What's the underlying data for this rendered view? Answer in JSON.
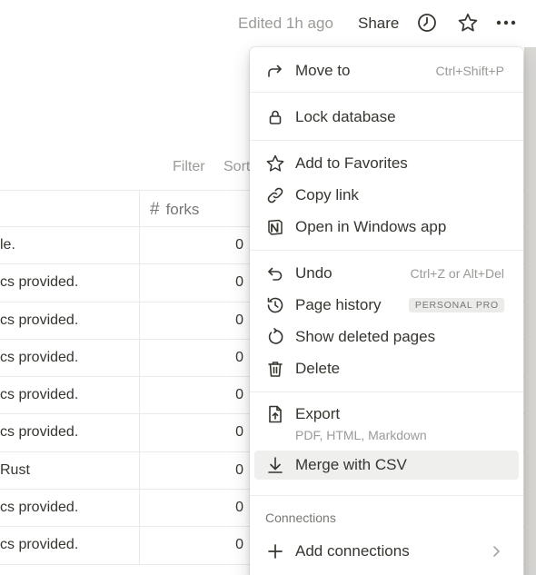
{
  "topbar": {
    "edited": "Edited 1h ago",
    "share": "Share",
    "icons": [
      "clock-icon",
      "star-icon",
      "more-icon"
    ]
  },
  "view": {
    "filter": "Filter",
    "sort": "Sort"
  },
  "table": {
    "forks_header": "forks",
    "rows": [
      {
        "desc": "le.",
        "forks": "0"
      },
      {
        "desc": "cs provided.",
        "forks": "0"
      },
      {
        "desc": "cs provided.",
        "forks": "0"
      },
      {
        "desc": "cs provided.",
        "forks": "0"
      },
      {
        "desc": "cs provided.",
        "forks": "0"
      },
      {
        "desc": "cs provided.",
        "forks": "0"
      },
      {
        "desc": "Rust",
        "forks": "0"
      },
      {
        "desc": "cs provided.",
        "forks": "0"
      },
      {
        "desc": "cs provided.",
        "forks": "0"
      }
    ]
  },
  "menu": {
    "move_to": {
      "label": "Move to",
      "shortcut": "Ctrl+Shift+P"
    },
    "lock": {
      "label": "Lock database"
    },
    "favorites": {
      "label": "Add to Favorites"
    },
    "copy_link": {
      "label": "Copy link"
    },
    "open_app": {
      "label": "Open in Windows app"
    },
    "undo": {
      "label": "Undo",
      "shortcut": "Ctrl+Z or Alt+Del"
    },
    "page_history": {
      "label": "Page history",
      "badge": "PERSONAL PRO"
    },
    "show_deleted": {
      "label": "Show deleted pages"
    },
    "delete": {
      "label": "Delete"
    },
    "export": {
      "label": "Export",
      "sublabel": "PDF, HTML, Markdown"
    },
    "merge_csv": {
      "label": "Merge with CSV"
    },
    "connections_header": "Connections",
    "add_connections": {
      "label": "Add connections"
    }
  },
  "colors": {
    "text": "#37352f",
    "muted": "#9b9a97",
    "hover": "#efefee",
    "divider": "#ebebea"
  }
}
